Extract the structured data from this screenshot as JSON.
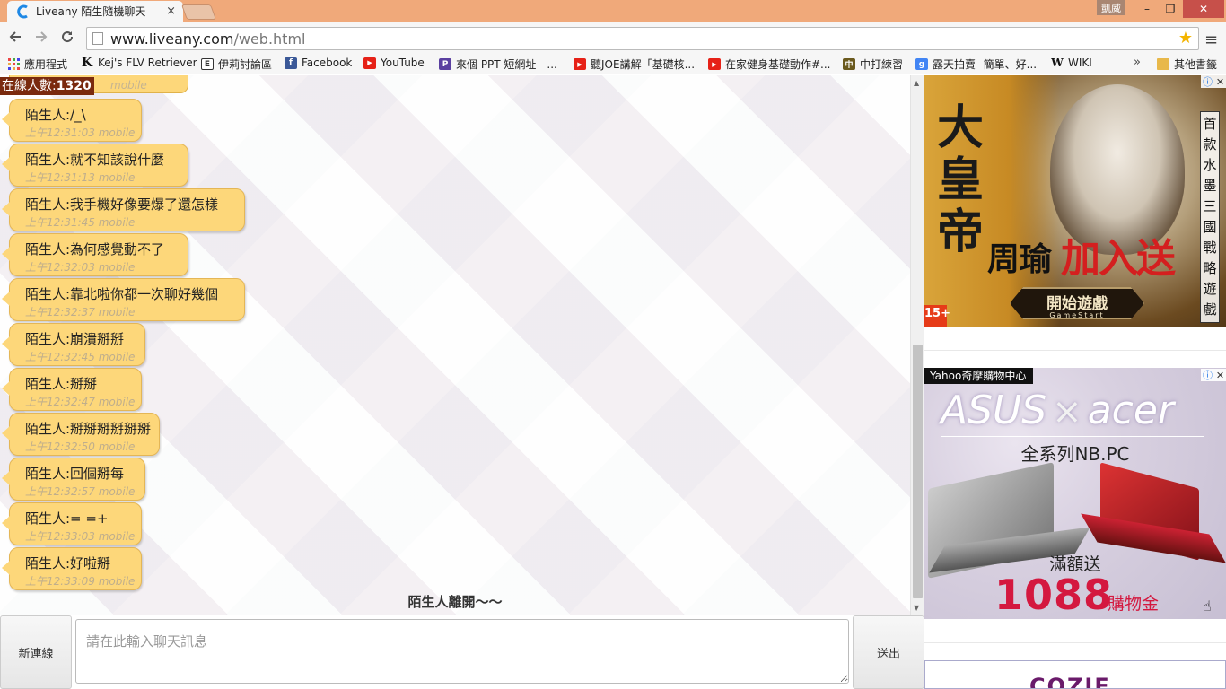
{
  "browser": {
    "tab_title": "Liveany 陌生隨機聊天",
    "tab_close": "×",
    "user_name": "凱威",
    "win_min": "–",
    "win_max": "❐",
    "win_close": "✕",
    "url_domain": "www.liveany.com",
    "url_path": "/web.html",
    "bookmarks": [
      {
        "label": "應用程式",
        "icon_color": "#e44"
      },
      {
        "label": "Kej's FLV Retriever",
        "icon": "K"
      },
      {
        "label": "伊莉討論區",
        "icon": "E"
      },
      {
        "label": "Facebook",
        "icon_color": "#3b5998"
      },
      {
        "label": "YouTube",
        "icon_color": "#e62117"
      },
      {
        "label": "來個 PPT 短網址 - ...",
        "icon_color": "#5a3fa0"
      },
      {
        "label": "聽JOE講解「基礎核...",
        "icon_color": "#e62117"
      },
      {
        "label": "在家健身基礎動作#...",
        "icon_color": "#e62117"
      },
      {
        "label": "中打練習",
        "icon_color": "#6b5a1e"
      },
      {
        "label": "露天拍賣--簡單、好...",
        "icon_color": "#4285f4"
      },
      {
        "label": "WIKI",
        "icon": "W"
      }
    ],
    "bookmarks_more": "»",
    "other_bookmarks": "其他書籤"
  },
  "chat": {
    "online_label": "在線人數:",
    "online_count": "1320",
    "first_partial_time": "mobile",
    "messages": [
      {
        "text": "陌生人:/_\\",
        "time": "上午12:31:03 mobile"
      },
      {
        "text": "陌生人:就不知該說什麼",
        "time": "上午12:31:13 mobile"
      },
      {
        "text": "陌生人:我手機好像要爆了還怎樣",
        "time": "上午12:31:45 mobile"
      },
      {
        "text": "陌生人:為何感覺動不了",
        "time": "上午12:32:03 mobile"
      },
      {
        "text": "陌生人:靠北啦你都一次聊好幾個",
        "time": "上午12:32:37 mobile"
      },
      {
        "text": "陌生人:崩潰掰掰",
        "time": "上午12:32:45 mobile"
      },
      {
        "text": "陌生人:掰掰",
        "time": "上午12:32:47 mobile"
      },
      {
        "text": "陌生人:掰掰掰掰掰掰",
        "time": "上午12:32:50 mobile"
      },
      {
        "text": "陌生人:回個掰每",
        "time": "上午12:32:57 mobile"
      },
      {
        "text": "陌生人:= =+",
        "time": "上午12:33:03 mobile"
      },
      {
        "text": "陌生人:好啦掰",
        "time": "上午12:33:09 mobile"
      }
    ],
    "leave_note": "陌生人離開〜〜",
    "new_connection": "新連線",
    "input_placeholder": "請在此輸入聊天訊息",
    "send": "送出"
  },
  "ads": {
    "ad1": {
      "title": "大皇帝",
      "line": "周瑜",
      "highlight": "加入送",
      "vertical": "首款水墨三國戰略遊戲",
      "cta": "開始遊戲",
      "cta_en": "GameStart",
      "rating": "15+"
    },
    "ad2": {
      "tag": "Yahoo奇摩購物中心",
      "brand_left": "ASUS",
      "brand_x": "×",
      "brand_right": "acer",
      "subtitle": "全系列NB.PC",
      "gift": "滿額送",
      "amount": "1088",
      "unit": "購物金"
    },
    "ad3": {
      "text": "COZIE"
    }
  }
}
